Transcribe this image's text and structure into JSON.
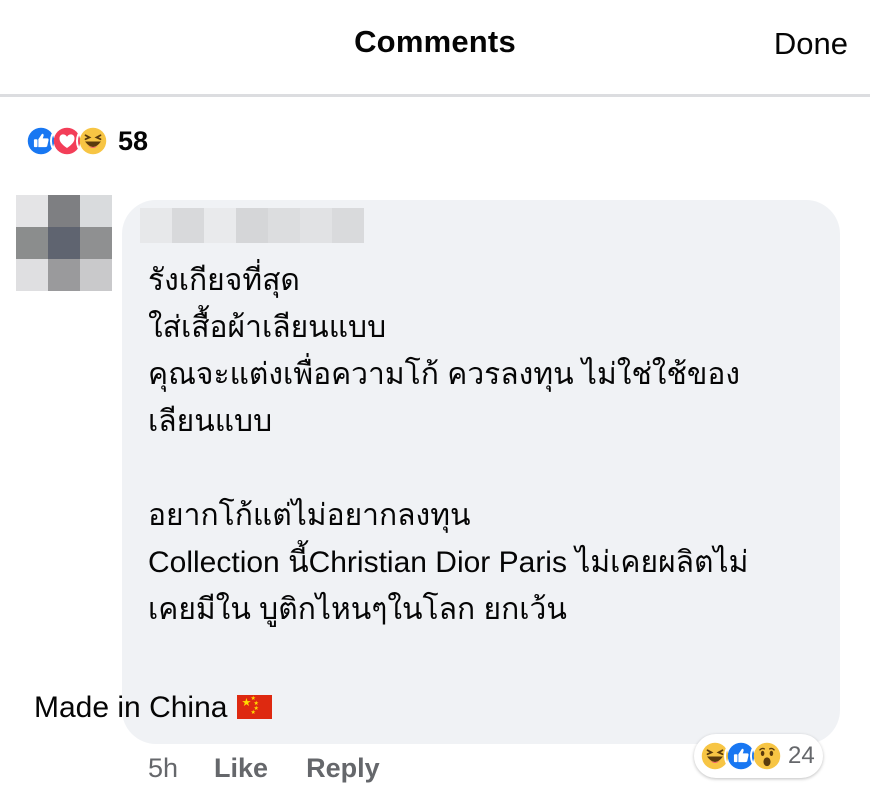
{
  "header": {
    "title": "Comments",
    "done_label": "Done"
  },
  "post_reactions": {
    "icons": [
      "like-icon",
      "love-icon",
      "haha-icon"
    ],
    "count": "58"
  },
  "comment": {
    "lines_part1": [
      "รังเกียจที่สุด",
      "ใส่เสื้อผ้าเลียนแบบ",
      "คุณจะแต่งเพื่อความโก้ ควรลงทุน ไม่ใช่ใช้ของ",
      "เลียนแบบ"
    ],
    "lines_part2": [
      "อยากโก้แต่ไม่อยากลงทุน",
      "Collection นี้Christian Dior Paris ไม่เคยผลิตไม่",
      "เคยมีใน บูติกไหนๆในโลก ยกเว้น"
    ],
    "closing_line": "Made in China",
    "closing_flag": "china-flag-icon",
    "timestamp": "5h",
    "like_label": "Like",
    "reply_label": "Reply",
    "reactions": {
      "icons": [
        "haha-icon",
        "like-icon",
        "wow-icon"
      ],
      "count": "24"
    }
  },
  "colors": {
    "like_blue": "#1877f2",
    "love_red": "#f33e58",
    "haha_yellow": "#f7c544",
    "bubble_bg": "#f0f2f5",
    "meta_gray": "#65676b",
    "divider": "#dcdde0"
  }
}
